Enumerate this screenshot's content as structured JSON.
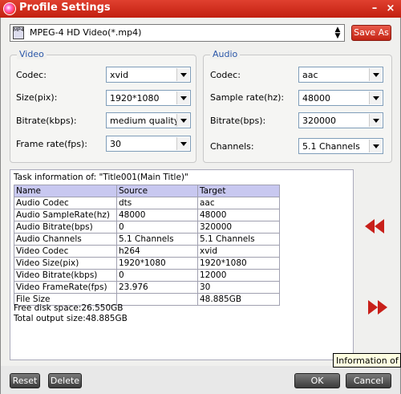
{
  "window": {
    "title": "Profile Settings",
    "minimize_glyph": "–",
    "close_glyph": "×"
  },
  "format": {
    "icon": "mp4-file-icon",
    "icon_text": "MP4",
    "value": "MPEG-4 HD Video(*.mp4)",
    "save_as_label": "Save As"
  },
  "video": {
    "legend": "Video",
    "codec_label": "Codec:",
    "codec_value": "xvid",
    "size_label": "Size(pix):",
    "size_value": "1920*1080",
    "bitrate_label": "Bitrate(kbps):",
    "bitrate_value": "medium quality",
    "framerate_label": "Frame rate(fps):",
    "framerate_value": "30"
  },
  "audio": {
    "legend": "Audio",
    "codec_label": "Codec:",
    "codec_value": "aac",
    "samplerate_label": "Sample rate(hz):",
    "samplerate_value": "48000",
    "bitrate_label": "Bitrate(bps):",
    "bitrate_value": "320000",
    "channels_label": "Channels:",
    "channels_value": "5.1 Channels"
  },
  "task": {
    "title": "Task information of: \"Title001(Main Title)\"",
    "columns": [
      "Name",
      "Source",
      "Target"
    ],
    "rows": [
      [
        "Audio Codec",
        "dts",
        "aac"
      ],
      [
        "Audio SampleRate(hz)",
        "48000",
        "48000"
      ],
      [
        "Audio Bitrate(bps)",
        "0",
        "320000"
      ],
      [
        "Audio Channels",
        "5.1 Channels",
        "5.1 Channels"
      ],
      [
        "Video Codec",
        "h264",
        "xvid"
      ],
      [
        "Video Size(pix)",
        "1920*1080",
        "1920*1080"
      ],
      [
        "Video Bitrate(kbps)",
        "0",
        "12000"
      ],
      [
        "Video FrameRate(fps)",
        "23.976",
        "30"
      ],
      [
        "File Size",
        "",
        "48.885GB"
      ]
    ],
    "free_disk": "Free disk space:26.550GB",
    "total_output": "Total output size:48.885GB"
  },
  "nav": {
    "prev_icon": "rewind-icon",
    "next_icon": "fast-forward-icon",
    "accent": "#c8201a"
  },
  "buttons": {
    "reset": "Reset",
    "delete": "Delete",
    "ok": "OK",
    "cancel": "Cancel"
  },
  "tooltip": "Information of"
}
